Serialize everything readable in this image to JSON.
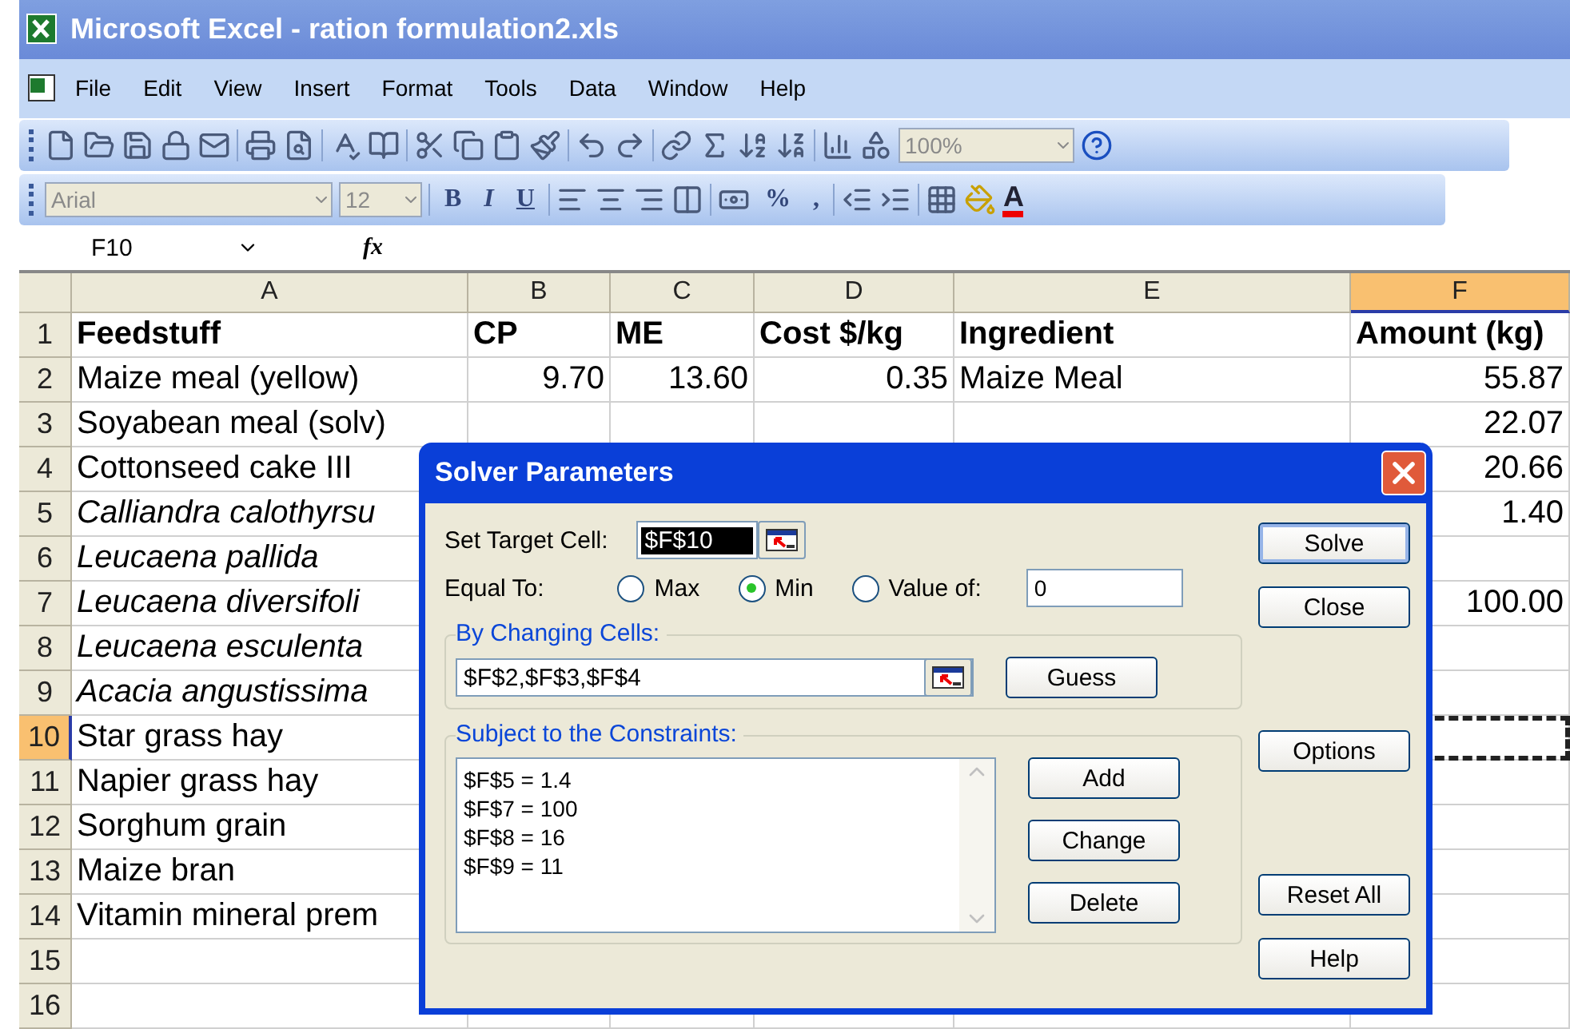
{
  "window": {
    "title": "Microsoft Excel - ration formulation2.xls"
  },
  "menu": [
    "File",
    "Edit",
    "View",
    "Insert",
    "Format",
    "Tools",
    "Data",
    "Window",
    "Help"
  ],
  "standard_toolbar": {
    "zoom": "100%"
  },
  "formatting_toolbar": {
    "font": "Arial",
    "size": "12",
    "bold": "B",
    "italic": "I",
    "underline": "U",
    "percent": "%",
    "comma": ",",
    "font_color": "A"
  },
  "formula_bar": {
    "name_box": "F10",
    "function_label": "fx"
  },
  "sheet": {
    "columns": [
      {
        "label": "A",
        "selected": false
      },
      {
        "label": "B",
        "selected": false
      },
      {
        "label": "C",
        "selected": false
      },
      {
        "label": "D",
        "selected": false
      },
      {
        "label": "E",
        "selected": false
      },
      {
        "label": "F",
        "selected": true
      }
    ],
    "rows": [
      {
        "label": "1",
        "selected": false,
        "cells": [
          {
            "text": "Feedstuff",
            "kind": "heading"
          },
          {
            "text": "CP",
            "kind": "heading"
          },
          {
            "text": "ME",
            "kind": "heading"
          },
          {
            "text": "Cost $/kg",
            "kind": "heading"
          },
          {
            "text": "Ingredient",
            "kind": "heading"
          },
          {
            "text": "Amount (kg)",
            "kind": "heading"
          }
        ]
      },
      {
        "label": "2",
        "selected": false,
        "cells": [
          {
            "text": "Maize meal (yellow)",
            "kind": "text"
          },
          {
            "text": "9.70",
            "kind": "number"
          },
          {
            "text": "13.60",
            "kind": "number"
          },
          {
            "text": "0.35",
            "kind": "number"
          },
          {
            "text": "Maize Meal",
            "kind": "text"
          },
          {
            "text": "55.87",
            "kind": "number"
          }
        ]
      },
      {
        "label": "3",
        "selected": false,
        "cells": [
          {
            "text": "Soyabean meal (solv)",
            "kind": "text"
          },
          null,
          null,
          null,
          null,
          {
            "text": "22.07",
            "kind": "number"
          }
        ]
      },
      {
        "label": "4",
        "selected": false,
        "cells": [
          {
            "text": "Cottonseed cake III",
            "kind": "text"
          },
          null,
          null,
          null,
          null,
          {
            "text": "20.66",
            "kind": "number"
          }
        ]
      },
      {
        "label": "5",
        "selected": false,
        "cells": [
          {
            "text": "Calliandra calothyrsu",
            "kind": "latin"
          },
          null,
          null,
          null,
          null,
          {
            "text": "1.40",
            "kind": "number"
          }
        ]
      },
      {
        "label": "6",
        "selected": false,
        "cells": [
          {
            "text": "Leucaena pallida",
            "kind": "latin"
          },
          null,
          null,
          null,
          null,
          null
        ]
      },
      {
        "label": "7",
        "selected": false,
        "cells": [
          {
            "text": "Leucaena diversifoli",
            "kind": "latin"
          },
          null,
          null,
          null,
          null,
          {
            "text": "100.00",
            "kind": "number"
          }
        ]
      },
      {
        "label": "8",
        "selected": false,
        "cells": [
          {
            "text": "Leucaena esculenta",
            "kind": "latin"
          },
          null,
          null,
          null,
          null,
          null
        ]
      },
      {
        "label": "9",
        "selected": false,
        "cells": [
          {
            "text": "Acacia angustissima",
            "kind": "latin"
          },
          null,
          null,
          null,
          null,
          null
        ]
      },
      {
        "label": "10",
        "selected": true,
        "cells": [
          {
            "text": "Star grass hay",
            "kind": "text"
          },
          null,
          null,
          null,
          null,
          null
        ]
      },
      {
        "label": "11",
        "selected": false,
        "cells": [
          {
            "text": "Napier grass hay",
            "kind": "text"
          },
          null,
          null,
          null,
          null,
          null
        ]
      },
      {
        "label": "12",
        "selected": false,
        "cells": [
          {
            "text": "Sorghum grain",
            "kind": "text"
          },
          null,
          null,
          null,
          null,
          null
        ]
      },
      {
        "label": "13",
        "selected": false,
        "cells": [
          {
            "text": "Maize bran",
            "kind": "text"
          },
          null,
          null,
          null,
          null,
          null
        ]
      },
      {
        "label": "14",
        "selected": false,
        "cells": [
          {
            "text": "Vitamin mineral prem",
            "kind": "text"
          },
          null,
          null,
          null,
          null,
          null
        ]
      },
      {
        "label": "15",
        "selected": false,
        "cells": [
          null,
          null,
          null,
          null,
          null,
          null
        ]
      },
      {
        "label": "16",
        "selected": false,
        "cells": [
          null,
          null,
          null,
          null,
          null,
          null
        ]
      }
    ]
  },
  "dialog": {
    "title": "Solver Parameters",
    "target_cell": {
      "label": "Set Target Cell:",
      "value": "$F$10"
    },
    "equal_to": {
      "label": "Equal To:",
      "options": [
        {
          "label": "Max",
          "selected": false
        },
        {
          "label": "Min",
          "selected": true
        },
        {
          "label": "Value of:",
          "selected": false
        }
      ],
      "value": "0"
    },
    "changing_cells": {
      "label": "By Changing Cells:",
      "value": "$F$2,$F$3,$F$4",
      "button": "Guess"
    },
    "constraints": {
      "label": "Subject to the Constraints:",
      "items": [
        "$F$5 = 1.4",
        "$F$7 = 100",
        "$F$8 = 16",
        "$F$9 = 11"
      ],
      "buttons": [
        "Add",
        "Change",
        "Delete"
      ]
    },
    "side_buttons": [
      {
        "label": "Solve",
        "default": true
      },
      {
        "label": "Close",
        "default": false
      },
      {
        "label": "Options",
        "default": false
      },
      {
        "label": "Reset All",
        "default": false
      },
      {
        "label": "Help",
        "default": false
      }
    ]
  }
}
